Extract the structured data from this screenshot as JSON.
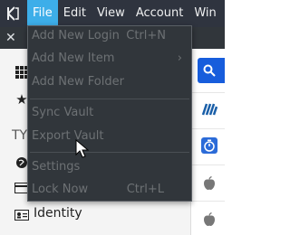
{
  "menubar": {
    "app_icon": "kde-icon",
    "menus": [
      {
        "label": "File"
      },
      {
        "label": "Edit"
      },
      {
        "label": "View"
      },
      {
        "label": "Account"
      },
      {
        "label": "Win"
      }
    ]
  },
  "file_menu": {
    "items": [
      {
        "label": "Add New Login",
        "shortcut": "Ctrl+N"
      },
      {
        "label": "Add New Item",
        "shortcut": "",
        "submenu": true
      },
      {
        "label": "Add New Folder",
        "shortcut": ""
      },
      {
        "label": "Sync Vault",
        "shortcut": ""
      },
      {
        "label": "Export Vault",
        "shortcut": ""
      },
      {
        "label": "Settings",
        "shortcut": ""
      },
      {
        "label": "Lock Now",
        "shortcut": "Ctrl+L"
      }
    ],
    "submenu_arrow": "›"
  },
  "sidebar": {
    "types_label": "TY",
    "identity_label": "Identity"
  },
  "colors": {
    "menubar_bg": "#2f343f",
    "active_menu": "#3daee9",
    "menu_bg": "#31363b",
    "disabled_text": "#6d7174",
    "accent_blue": "#175ddc"
  }
}
